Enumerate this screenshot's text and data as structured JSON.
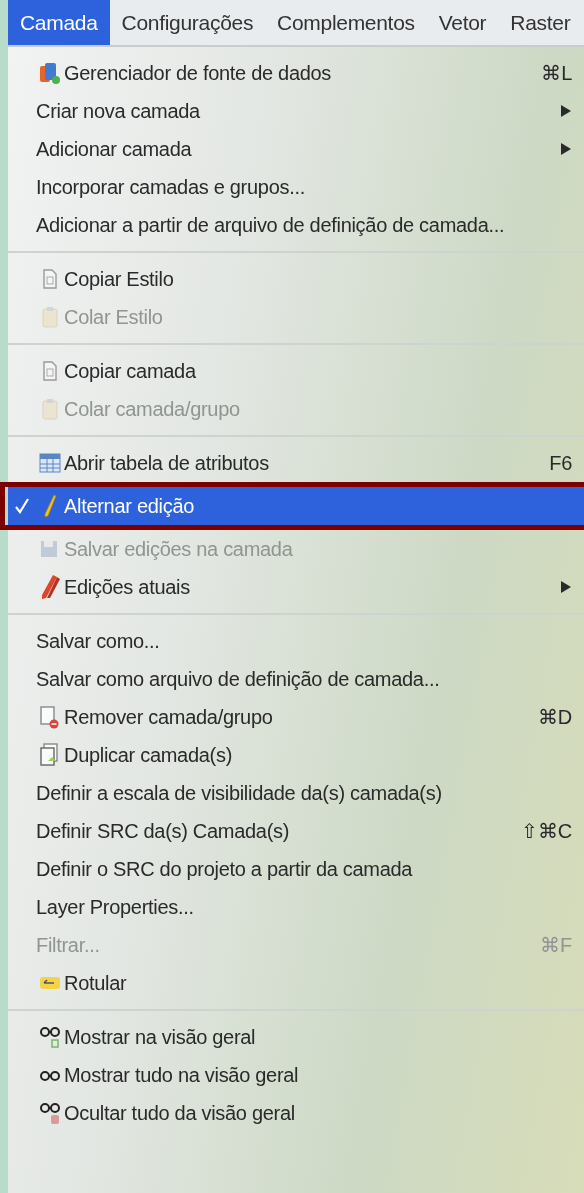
{
  "menubar": [
    {
      "label": "Camada",
      "selected": true
    },
    {
      "label": "Configurações",
      "selected": false
    },
    {
      "label": "Complementos",
      "selected": false
    },
    {
      "label": "Vetor",
      "selected": false
    },
    {
      "label": "Raster",
      "selected": false
    }
  ],
  "sections": [
    {
      "items": [
        {
          "label": "Gerenciador de fonte de dados",
          "shortcut": "⌘L",
          "submenu": false,
          "disabled": false,
          "checked": false,
          "selected": false
        },
        {
          "label": "Criar nova camada",
          "submenu": true,
          "disabled": false,
          "checked": false,
          "selected": false
        },
        {
          "label": "Adicionar camada",
          "submenu": true,
          "disabled": false,
          "checked": false,
          "selected": false
        },
        {
          "label": "Incorporar camadas e grupos...",
          "submenu": false,
          "disabled": false,
          "checked": false,
          "selected": false
        },
        {
          "label": "Adicionar a partir de arquivo de definição de camada...",
          "submenu": false,
          "disabled": false,
          "checked": false,
          "selected": false
        }
      ]
    },
    {
      "items": [
        {
          "label": "Copiar Estilo",
          "submenu": false,
          "disabled": false,
          "checked": false,
          "selected": false
        },
        {
          "label": "Colar Estilo",
          "submenu": false,
          "disabled": true,
          "checked": false,
          "selected": false
        }
      ]
    },
    {
      "items": [
        {
          "label": "Copiar camada",
          "submenu": false,
          "disabled": false,
          "checked": false,
          "selected": false
        },
        {
          "label": "Colar camada/grupo",
          "submenu": false,
          "disabled": true,
          "checked": false,
          "selected": false
        }
      ]
    },
    {
      "items": [
        {
          "label": "Abrir tabela de atributos",
          "shortcut": "F6",
          "submenu": false,
          "disabled": false,
          "checked": false,
          "selected": false
        },
        {
          "label": "Alternar edição",
          "submenu": false,
          "disabled": false,
          "checked": true,
          "selected": true
        },
        {
          "label": "Salvar edições na camada",
          "submenu": false,
          "disabled": true,
          "checked": false,
          "selected": false
        },
        {
          "label": "Edições atuais",
          "submenu": true,
          "disabled": false,
          "checked": false,
          "selected": false
        }
      ]
    },
    {
      "items": [
        {
          "label": "Salvar como...",
          "submenu": false,
          "disabled": false,
          "checked": false,
          "selected": false
        },
        {
          "label": "Salvar como arquivo de definição de camada...",
          "submenu": false,
          "disabled": false,
          "checked": false,
          "selected": false
        },
        {
          "label": "Remover camada/grupo",
          "shortcut": "⌘D",
          "submenu": false,
          "disabled": false,
          "checked": false,
          "selected": false
        },
        {
          "label": "Duplicar camada(s)",
          "submenu": false,
          "disabled": false,
          "checked": false,
          "selected": false
        },
        {
          "label": "Definir a escala de visibilidade da(s) camada(s)",
          "submenu": false,
          "disabled": false,
          "checked": false,
          "selected": false
        },
        {
          "label": "Definir SRC da(s) Camada(s)",
          "shortcut": "⇧⌘C",
          "submenu": false,
          "disabled": false,
          "checked": false,
          "selected": false
        },
        {
          "label": "Definir o SRC do projeto a partir da camada",
          "submenu": false,
          "disabled": false,
          "checked": false,
          "selected": false
        },
        {
          "label": "Layer Properties...",
          "submenu": false,
          "disabled": false,
          "checked": false,
          "selected": false
        },
        {
          "label": "Filtrar...",
          "shortcut": "⌘F",
          "submenu": false,
          "disabled": true,
          "checked": false,
          "selected": false
        },
        {
          "label": "Rotular",
          "submenu": false,
          "disabled": false,
          "checked": false,
          "selected": false
        }
      ]
    },
    {
      "items": [
        {
          "label": "Mostrar na visão geral",
          "submenu": false,
          "disabled": false,
          "checked": false,
          "selected": false
        },
        {
          "label": "Mostrar tudo na visão geral",
          "submenu": false,
          "disabled": false,
          "checked": false,
          "selected": false
        },
        {
          "label": "Ocultar tudo da visão geral",
          "submenu": false,
          "disabled": false,
          "checked": false,
          "selected": false
        }
      ]
    }
  ]
}
